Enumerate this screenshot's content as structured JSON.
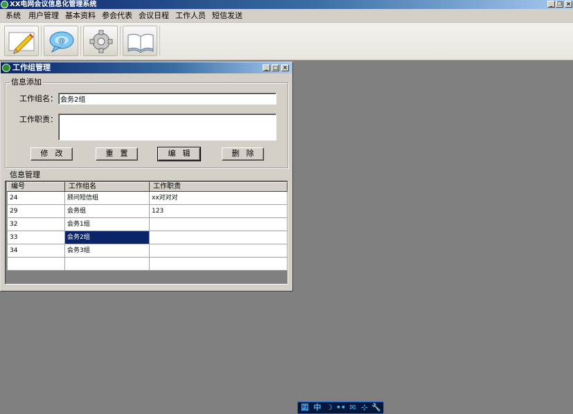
{
  "app": {
    "title": "XX电网会议信息化管理系统",
    "controls": {
      "minimize": "_",
      "restore": "❐",
      "close": "×"
    }
  },
  "menu": {
    "items": [
      "系统",
      "用户管理",
      "基本资料",
      "参会代表",
      "会议日程",
      "工作人员",
      "短信发送"
    ]
  },
  "toolbar": {
    "buttons": [
      {
        "icon": "pencil-icon"
      },
      {
        "icon": "chat-bubble-icon"
      },
      {
        "icon": "gear-icon"
      },
      {
        "icon": "open-book-icon"
      }
    ]
  },
  "window": {
    "title": "工作组管理",
    "controls": {
      "minimize": "_",
      "maximize": "□",
      "close": "×"
    },
    "add_group": {
      "title": "信息添加",
      "name_label": "工作组名：",
      "name_value": "会务2组",
      "duty_label": "工作职责：",
      "duty_value": ""
    },
    "buttons": {
      "modify": "修改",
      "reset": "重置",
      "edit": "编辑",
      "delete": "删除"
    },
    "manage_group": {
      "title": "信息管理",
      "columns": [
        "编号",
        "工作组名",
        "工作职责"
      ],
      "rows": [
        [
          "24",
          "顾问短信组",
          "xx对对对"
        ],
        [
          "29",
          "会务组",
          "123"
        ],
        [
          "32",
          "会务1组",
          ""
        ],
        [
          "33",
          "会务2组",
          ""
        ],
        [
          "34",
          "会务3组",
          ""
        ],
        [
          "",
          "",
          ""
        ]
      ],
      "selected_row": 3,
      "selected_col": 1
    }
  },
  "ime_bar": {
    "items": [
      "囸",
      "中",
      "☽",
      "••",
      "✉",
      "⊹",
      "🔧"
    ]
  },
  "colors": {
    "desktop": "#808080",
    "face": "#d4d0c8",
    "title_dark": "#0a246a",
    "title_light": "#a6caf0",
    "selection": "#0a246a"
  }
}
